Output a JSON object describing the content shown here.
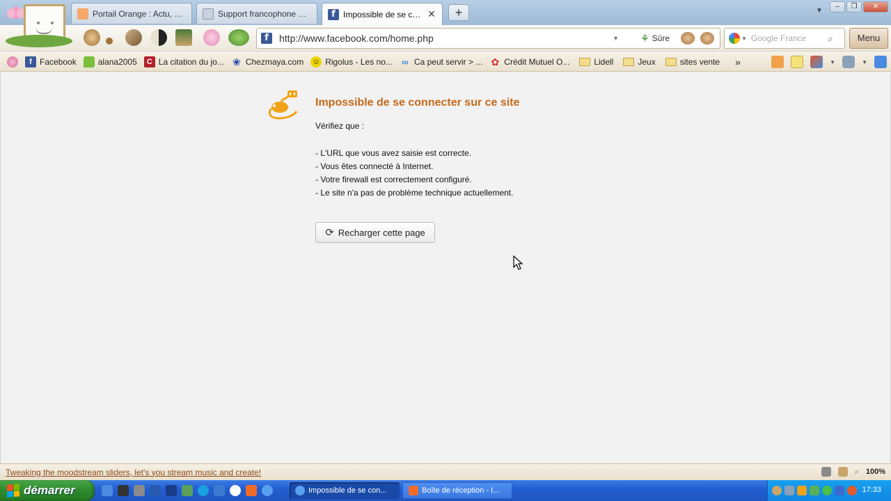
{
  "browser": {
    "tabs": [
      {
        "label": "Portail Orange : Actu, Sp...",
        "favicon_color": "#f7a86a",
        "active": false
      },
      {
        "label": "Support francophone de...",
        "favicon_color": "#c9d2dc",
        "active": false
      },
      {
        "label": "Impossible de se con...",
        "favicon_color": "#3b5998",
        "active": true
      }
    ],
    "newtab_label": "+",
    "close_tab_glyph": "✕",
    "address": {
      "url": "http://www.facebook.com/home.php",
      "security_label": "Sûre"
    },
    "search": {
      "placeholder": "Google France"
    },
    "menu_label": "Menu"
  },
  "bookmarks": [
    {
      "label": "Facebook",
      "icon": "facebook-icon",
      "color": "#3b5998",
      "glyph": "f"
    },
    {
      "label": "alana2005",
      "icon": "chat-icon",
      "color": "#7bbf3a",
      "glyph": ""
    },
    {
      "label": "La citation du jo...",
      "icon": "citation-icon",
      "color": "#b3202a",
      "glyph": "C"
    },
    {
      "label": "Chezmaya.com",
      "icon": "paw-icon",
      "color": "#1b3ea8",
      "glyph": "❀"
    },
    {
      "label": "Rigolus - Les no...",
      "icon": "smiley-icon",
      "color": "#f1d400",
      "glyph": "☺"
    },
    {
      "label": "Ca peut servir > ...",
      "icon": "link-icon",
      "color": "#4a8ae0",
      "glyph": "∞"
    },
    {
      "label": "Crédit Mutuel O...",
      "icon": "bank-icon",
      "color": "#d22d2d",
      "glyph": "✿"
    },
    {
      "label": "Lidell",
      "icon": "folder-icon"
    },
    {
      "label": "Jeux",
      "icon": "folder-icon"
    },
    {
      "label": "sites vente",
      "icon": "folder-icon"
    }
  ],
  "bookmarks_more": "»",
  "page": {
    "title": "Impossible de se connecter sur ce site",
    "lead": "Vérifiez que :",
    "items": [
      "- L'URL que vous avez saisie est correcte.",
      "- Vous êtes connecté à Internet.",
      "- Votre firewall est correctement configuré.",
      "- Le site n'a pas de problème technique actuellement."
    ],
    "reload_label": "Recharger cette page"
  },
  "status": {
    "message": "Tweaking the moodstream sliders, let's you stream music and create!",
    "zoom": "100%"
  },
  "taskbar": {
    "start_label": "démarrer",
    "tasks": [
      {
        "label": "Impossible de se con...",
        "active": true,
        "icon_color": "#5aa0f0"
      },
      {
        "label": "Boîte de réception - I...",
        "active": false,
        "icon_color": "#f26b2a"
      }
    ],
    "clock": "17:33"
  }
}
